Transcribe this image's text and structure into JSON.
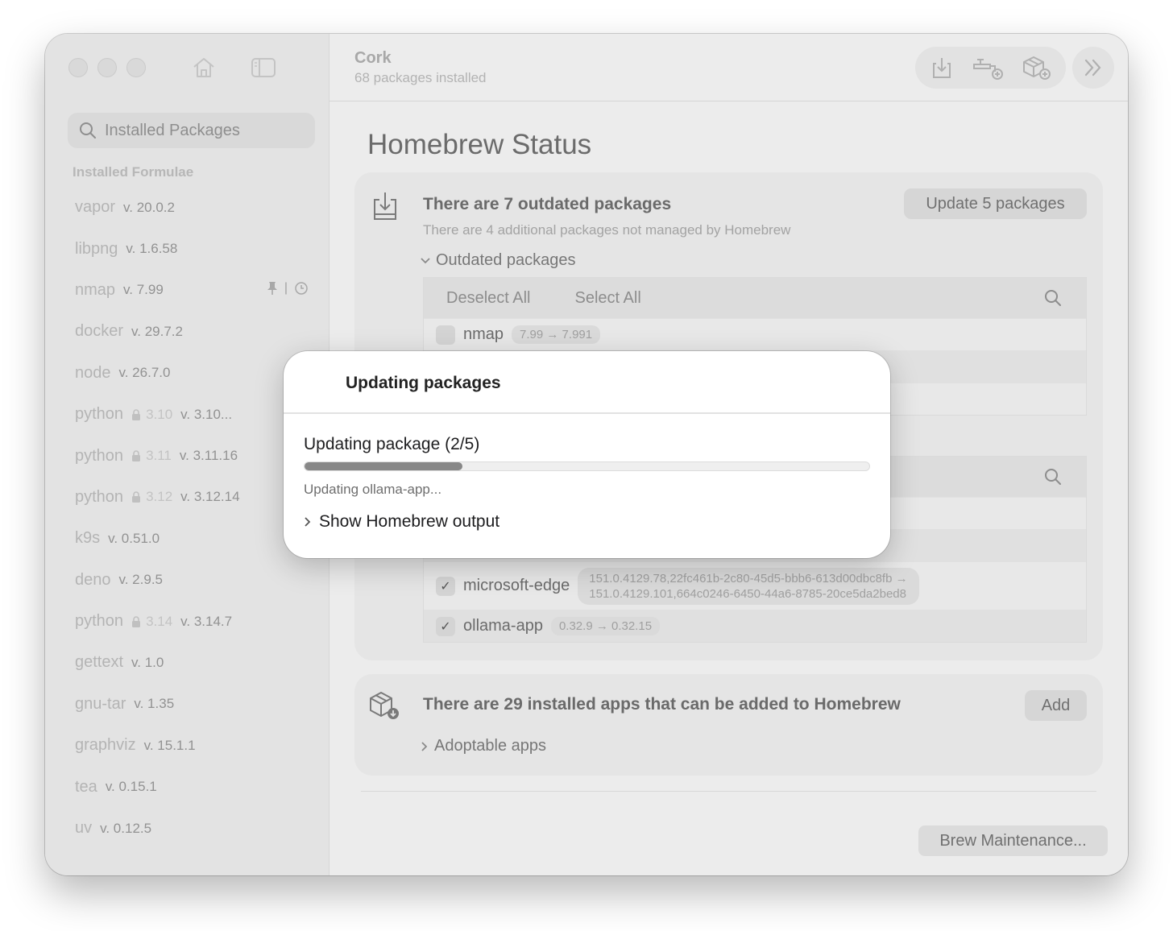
{
  "app": {
    "title": "Cork",
    "subtitle": "68 packages installed"
  },
  "sidebar": {
    "search_placeholder": "Installed Packages",
    "section_title": "Installed Formulae",
    "items": [
      {
        "name": "vapor",
        "version": "v. 20.0.2"
      },
      {
        "name": "libpng",
        "version": "v. 1.6.58"
      },
      {
        "name": "nmap",
        "version": "v. 7.99",
        "pinned": true,
        "extra_sep": "|"
      },
      {
        "name": "docker",
        "version": "v. 29.7.2"
      },
      {
        "name": "node",
        "version": "v. 26.7.0"
      },
      {
        "name": "python",
        "tag": "3.10",
        "version": "v. 3.10...",
        "pinned": true,
        "extra_sep": "|"
      },
      {
        "name": "python",
        "tag": "3.11",
        "version": "v. 3.11.16"
      },
      {
        "name": "python",
        "tag": "3.12",
        "version": "v. 3.12.14"
      },
      {
        "name": "k9s",
        "version": "v. 0.51.0"
      },
      {
        "name": "deno",
        "version": "v. 2.9.5"
      },
      {
        "name": "python",
        "tag": "3.14",
        "version": "v. 3.14.7"
      },
      {
        "name": "gettext",
        "version": "v. 1.0"
      },
      {
        "name": "gnu-tar",
        "version": "v. 1.35"
      },
      {
        "name": "graphviz",
        "version": "v. 15.1.1"
      },
      {
        "name": "tea",
        "version": "v. 0.15.1"
      },
      {
        "name": "uv",
        "version": "v. 0.12.5"
      }
    ]
  },
  "main": {
    "page_title": "Homebrew Status",
    "outdated_card": {
      "title": "There are 7 outdated packages",
      "subtitle": "There are 4 additional packages not managed by Homebrew",
      "update_button": "Update 5 packages",
      "disclosure": "Outdated packages",
      "deselect_all": "Deselect All",
      "select_all": "Select All",
      "rows": [
        {
          "name": "nmap",
          "versions": "7.99 → 7.991",
          "checked": false
        }
      ],
      "bottom_rows": [
        {
          "name": "microsoft-edge",
          "versions_line1": "151.0.4129.78,22fc461b-2c80-45d5-bbb6-613d00dbc8fb →",
          "versions_line2": "151.0.4129.101,664c0246-6450-44a6-8785-20ce5da2bed8",
          "checked": true
        },
        {
          "name": "ollama-app",
          "versions": "0.32.9 → 0.32.15",
          "checked": true
        }
      ]
    },
    "adopt_card": {
      "title": "There are 29 installed apps that can be added to Homebrew",
      "add_button": "Add",
      "disclosure": "Adoptable apps"
    },
    "maintenance_button": "Brew Maintenance..."
  },
  "dialog": {
    "title": "Updating packages",
    "status": "Updating package (2/5)",
    "progress": 0.28,
    "detail": "Updating ollama-app...",
    "output_toggle": "Show Homebrew output"
  },
  "colors": {
    "progress_fill": "#888888",
    "dim_overlay": "#ececec"
  }
}
